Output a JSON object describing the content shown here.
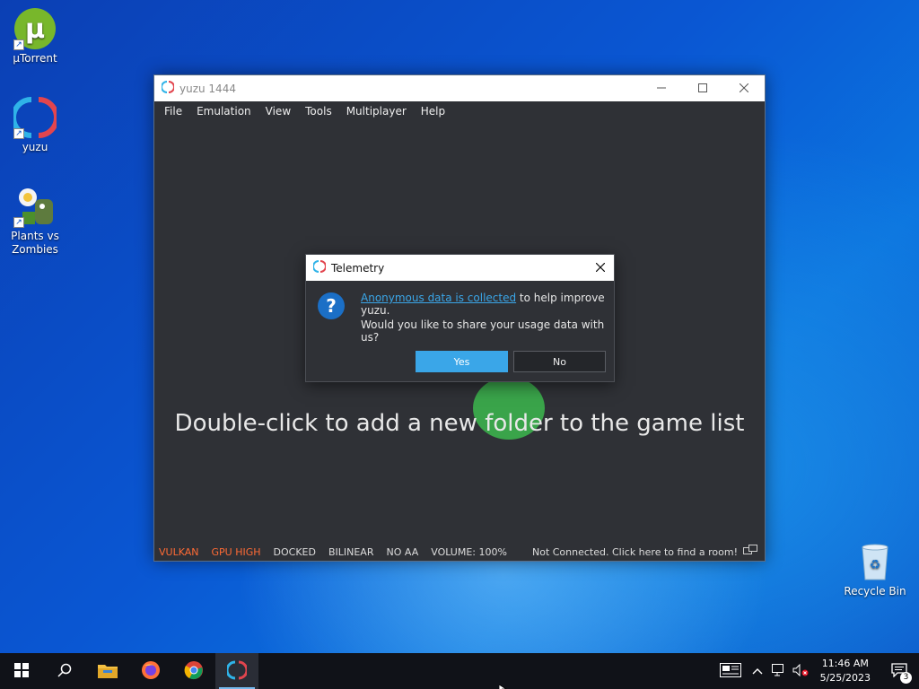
{
  "desktop": {
    "icons": [
      {
        "label": "µTorrent"
      },
      {
        "label": "yuzu"
      },
      {
        "label": "Plants vs Zombies"
      },
      {
        "label": "Recycle Bin"
      }
    ]
  },
  "window": {
    "title": "yuzu 1444",
    "menu": [
      "File",
      "Emulation",
      "View",
      "Tools",
      "Multiplayer",
      "Help"
    ],
    "placeholder": "Double-click to add a new folder to the game list",
    "status": {
      "renderer": "VULKAN",
      "gpu": "GPU HIGH",
      "dock": "DOCKED",
      "filter": "BILINEAR",
      "aa": "NO AA",
      "volume": "VOLUME: 100%",
      "room": "Not Connected. Click here to find a room!"
    },
    "colors": {
      "status_warning": "#ff6b35",
      "background": "#2f3136"
    }
  },
  "dialog": {
    "title": "Telemetry",
    "link_text": "Anonymous data is collected",
    "message_rest": " to help improve yuzu.",
    "question": "Would you like to share your usage data with us?",
    "yes_label": "Yes",
    "no_label": "No",
    "colors": {
      "accent": "#3aa6e8"
    }
  },
  "taskbar": {
    "apps": [
      "start-icon",
      "search-icon",
      "file-explorer-icon",
      "firefox-icon",
      "chrome-icon",
      "yuzu-icon"
    ],
    "time": "11:46 AM",
    "date": "5/25/2023",
    "notifications": "3"
  }
}
